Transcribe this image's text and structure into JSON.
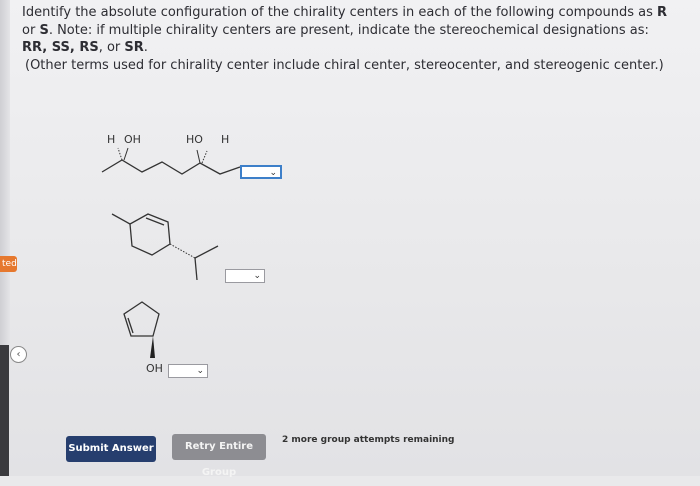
{
  "question": {
    "line1_text": "Identify the absolute configuration of the chirality centers in each of the following compounds as ",
    "line1_bold": "R",
    "line2_pre": "or ",
    "line2_bold": "S",
    "line2_text": ". Note: if multiple chirality centers are present, indicate the stereochemical designations as:",
    "line3_bold": "RR, SS, RS",
    "line3_mid": ", or ",
    "line3_bold2": "SR",
    "line3_end": ".",
    "note": "(Other terms used for chirality center include chiral center, stereocenter, and stereogenic center.)"
  },
  "structures": {
    "s1": {
      "label_h_left": "H",
      "label_oh": "OH",
      "label_ho": "HO",
      "label_h_right": "H"
    },
    "s3": {
      "label_oh": "OH"
    }
  },
  "sidebar": {
    "tab_label": "ted",
    "nav_icon": "chevron-left-icon"
  },
  "buttons": {
    "submit_label": "Submit Answer",
    "retry_label": "Retry Entire Group"
  },
  "status": {
    "attempts_text": "2 more group attempts remaining"
  },
  "colors": {
    "submit_bg": "#263e6e",
    "retry_bg": "#8d8d92",
    "tab_badge": "#e6782e",
    "active_select": "#3d7fc9"
  }
}
